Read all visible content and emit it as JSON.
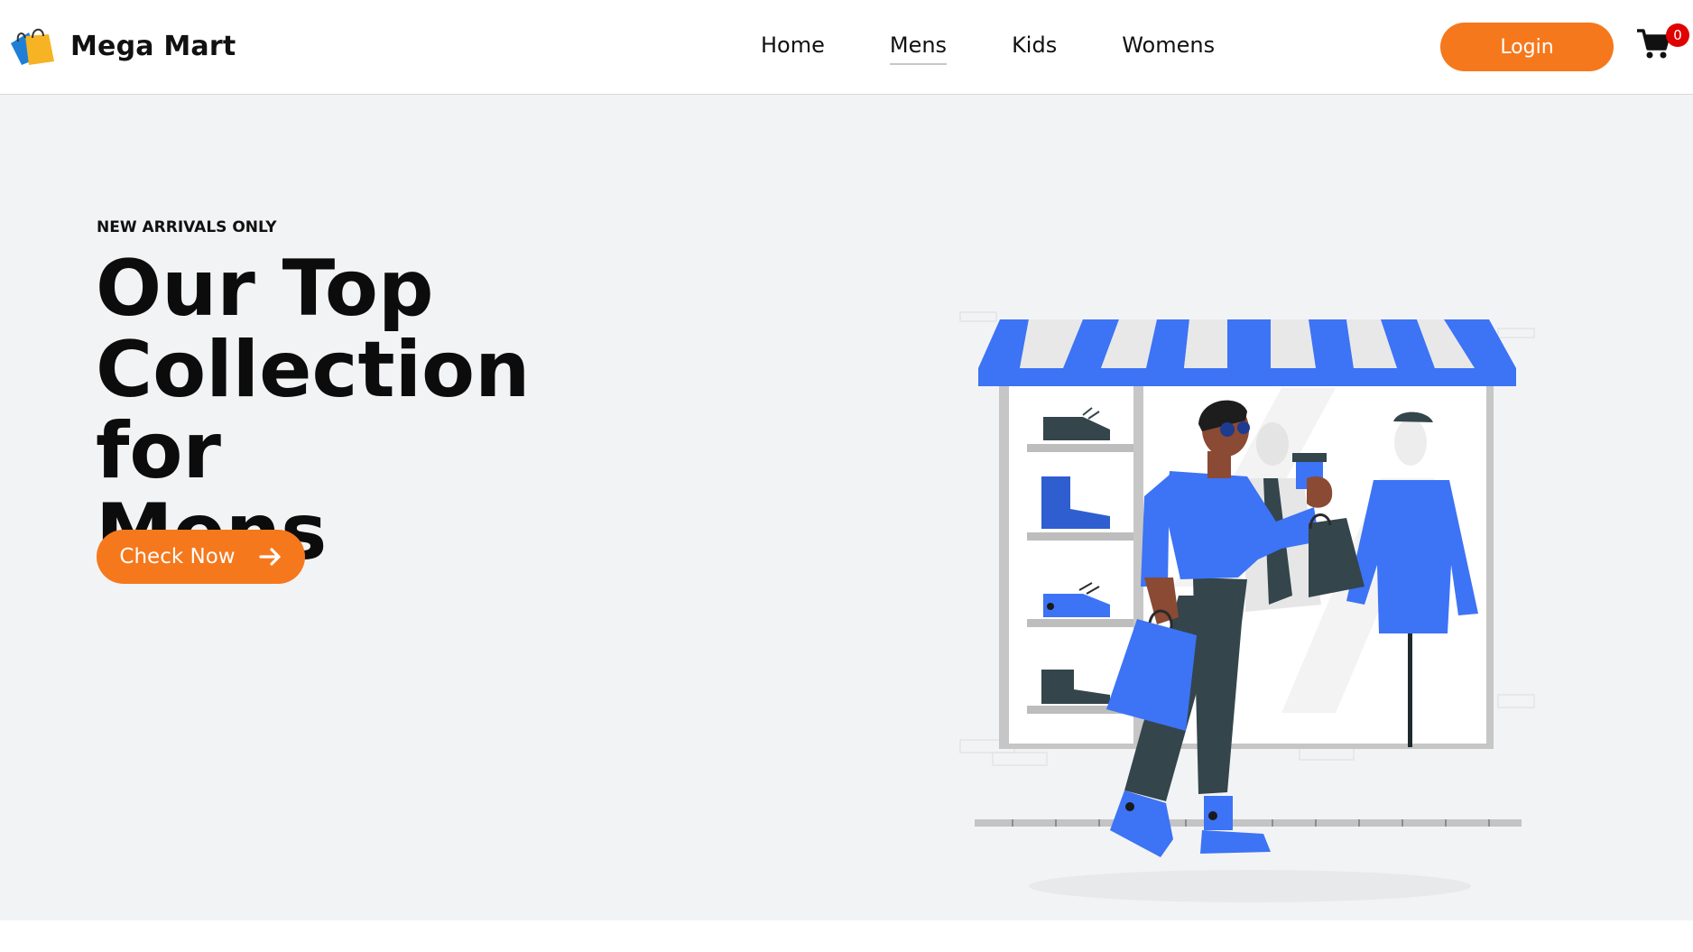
{
  "header": {
    "brand": {
      "name": "Mega Mart",
      "logo_icon": "shopping-bags-logo"
    },
    "nav": [
      {
        "label": "Home",
        "active": false
      },
      {
        "label": "Mens",
        "active": true
      },
      {
        "label": "Kids",
        "active": false
      },
      {
        "label": "Womens",
        "active": false
      }
    ],
    "login_label": "Login",
    "cart": {
      "icon": "cart-icon",
      "count": "0"
    }
  },
  "hero": {
    "eyebrow": "NEW ARRIVALS ONLY",
    "title_lines": [
      "Our Top",
      "Collection for",
      "Mens"
    ],
    "cta_label": "Check Now",
    "cta_icon": "arrow-right-icon",
    "illustration": "man-shopping-in-front-of-store-illustration"
  },
  "colors": {
    "accent": "#f6781c",
    "hero_bg": "#f2f3f5",
    "illustration_blue": "#3d73f5",
    "badge": "#e00000"
  }
}
